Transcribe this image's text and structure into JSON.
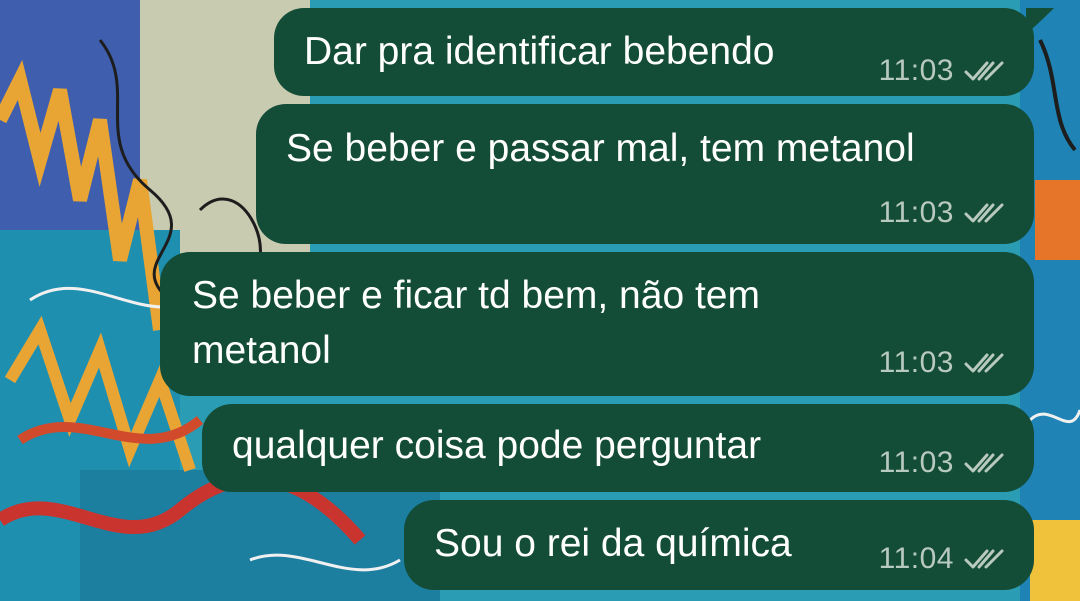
{
  "messages": [
    {
      "text": "Dar pra identificar bebendo",
      "time": "11:03",
      "status_icon": "double-check-icon"
    },
    {
      "text": "Se beber e passar mal, tem metanol",
      "time": "11:03",
      "status_icon": "double-check-icon"
    },
    {
      "text": "Se beber e ficar td bem, não tem\nmetanol",
      "time": "11:03",
      "status_icon": "double-check-icon"
    },
    {
      "text": "qualquer coisa pode perguntar",
      "time": "11:03",
      "status_icon": "double-check-icon"
    },
    {
      "text": "Sou o rei da química",
      "time": "11:04",
      "status_icon": "double-check-icon"
    }
  ],
  "colors": {
    "bubble_outgoing": "#144d37",
    "time_text": "#b8c9c0",
    "message_text": "#ffffff"
  }
}
